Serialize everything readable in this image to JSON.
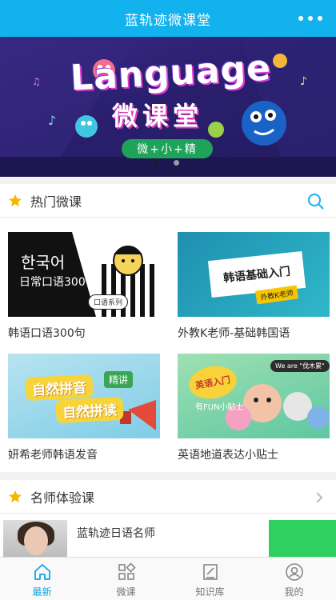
{
  "app": {
    "title": "蓝轨迹微课堂"
  },
  "banner": {
    "headline": "Language",
    "subtitle": "微课堂",
    "pill": "微+小+精",
    "slide_count": 2,
    "active_index": 0
  },
  "hot": {
    "title": "热门微课",
    "courses": [
      {
        "caption": "韩语口语300句",
        "thumb_text": {
          "korean": "한국어",
          "title": "日常口语300句",
          "tag": "口语系列"
        }
      },
      {
        "caption": "外教K老师-基础韩国语",
        "thumb_text": {
          "title": "韩语基础入门",
          "tag": "外教K老师"
        }
      },
      {
        "caption": "妍希老师韩语发音",
        "thumb_text": {
          "line1": "自然拼音",
          "line2": "自然拼读",
          "badge": "精讲"
        }
      },
      {
        "caption": "英语地道表达小贴士",
        "thumb_text": {
          "bubble": "英语入门",
          "line": "有FUN小贴士",
          "badge": "We are \"伐木累\""
        }
      }
    ]
  },
  "teachers": {
    "title": "名师体验课",
    "items": [
      {
        "name": "蓝轨迹日语名师"
      }
    ]
  },
  "tabs": [
    {
      "label": "最新",
      "icon": "home-icon",
      "active": true
    },
    {
      "label": "微课",
      "icon": "grid-icon",
      "active": false
    },
    {
      "label": "知识库",
      "icon": "note-icon",
      "active": false
    },
    {
      "label": "我的",
      "icon": "user-icon",
      "active": false
    }
  ],
  "colors": {
    "primary": "#12b2ee",
    "star": "#f5b800",
    "cta": "#2ed060"
  }
}
